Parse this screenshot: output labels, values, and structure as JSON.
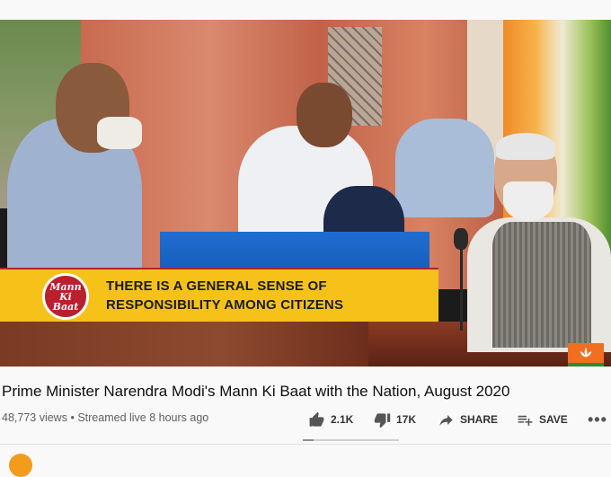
{
  "video": {
    "banner_logo_text": "Mann\nKi\nBaat",
    "banner_line1": "THERE IS A GENERAL SENSE OF",
    "banner_line2": "RESPONSIBILITY AMONG CITIZENS",
    "title": "Prime Minister Narendra Modi's Mann Ki Baat with the Nation, August 2020",
    "views": "48,773 views",
    "separator": "•",
    "streamed": "Streamed live 8 hours ago"
  },
  "actions": {
    "like_count": "2.1K",
    "dislike_count": "17K",
    "share_label": "SHARE",
    "save_label": "SAVE",
    "more_label": "•••",
    "like_ratio": 0.11
  },
  "colors": {
    "banner": "#f6c21a",
    "logo": "#b6212e",
    "text": "#0f0f0f",
    "meta": "#606060"
  },
  "icons": [
    "thumbs-up-icon",
    "thumbs-down-icon",
    "share-icon",
    "save-playlist-icon",
    "more-icon",
    "bjp-lotus-icon"
  ]
}
